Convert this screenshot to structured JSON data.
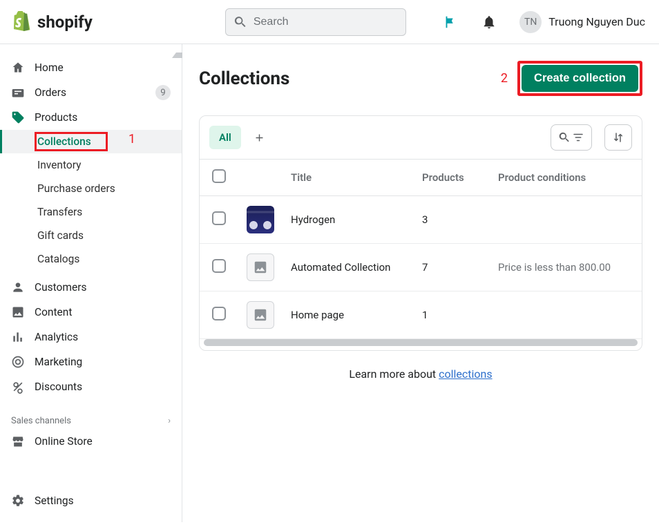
{
  "topbar": {
    "search_placeholder": "Search",
    "user_initials": "TN",
    "user_name": "Truong Nguyen Duc"
  },
  "sidebar": {
    "items": [
      {
        "label": "Home"
      },
      {
        "label": "Orders",
        "badge": "9"
      },
      {
        "label": "Products"
      },
      {
        "label": "Customers"
      },
      {
        "label": "Content"
      },
      {
        "label": "Analytics"
      },
      {
        "label": "Marketing"
      },
      {
        "label": "Discounts"
      }
    ],
    "product_sub": [
      {
        "label": "Collections"
      },
      {
        "label": "Inventory"
      },
      {
        "label": "Purchase orders"
      },
      {
        "label": "Transfers"
      },
      {
        "label": "Gift cards"
      },
      {
        "label": "Catalogs"
      }
    ],
    "section_channels": "Sales channels",
    "online_store": "Online Store",
    "settings": "Settings"
  },
  "annotations": {
    "a1": "1",
    "a2": "2"
  },
  "page": {
    "title": "Collections",
    "create_btn": "Create collection",
    "tab_all": "All",
    "learn_more_prefix": "Learn more about ",
    "learn_more_link": "collections"
  },
  "table": {
    "headers": {
      "title": "Title",
      "products": "Products",
      "conditions": "Product conditions"
    },
    "rows": [
      {
        "title": "Hydrogen",
        "products": "3",
        "conditions": "",
        "thumb": "img"
      },
      {
        "title": "Automated Collection",
        "products": "7",
        "conditions": "Price is less than 800.00",
        "thumb": "placeholder"
      },
      {
        "title": "Home page",
        "products": "1",
        "conditions": "",
        "thumb": "placeholder"
      }
    ]
  }
}
